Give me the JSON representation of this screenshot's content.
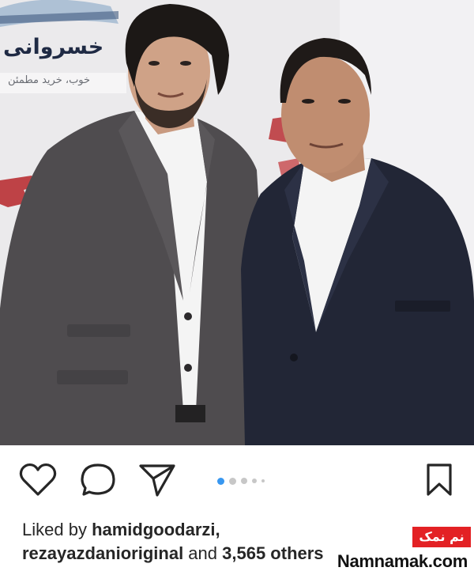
{
  "photo": {
    "banner_text": "خسروانی",
    "banner_sub": "خوب، خرید مطمئن"
  },
  "actions": {
    "like_icon": "heart-icon",
    "comment_icon": "comment-icon",
    "share_icon": "paper-plane-icon",
    "save_icon": "bookmark-icon",
    "carousel": {
      "count": 5,
      "active_index": 0
    }
  },
  "likes": {
    "prefix": "Liked by ",
    "user1": "hamidgoodarzi",
    "comma": ",",
    "user2": "rezayazdanioriginal",
    "middle": " and ",
    "count": "3,565",
    "suffix": " others"
  },
  "watermark": {
    "badge": "نم نمک",
    "site": "Namnamak.com"
  },
  "colors": {
    "accent": "#3897f0",
    "watermark_red": "#e32124",
    "text": "#262626"
  }
}
